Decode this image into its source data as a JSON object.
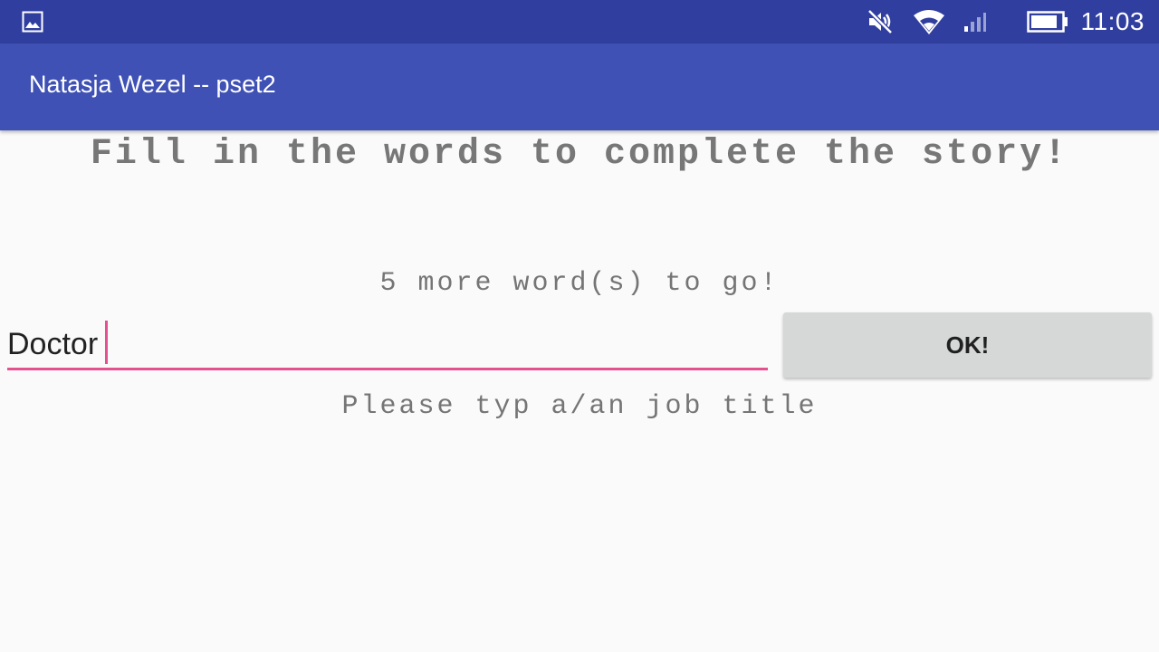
{
  "status_bar": {
    "time": "11:03",
    "icons": [
      "gallery-icon",
      "mute-icon",
      "wifi-icon",
      "signal-icon",
      "battery-icon"
    ],
    "background": "#303f9f"
  },
  "app_bar": {
    "title": "Natasja Wezel -- pset2",
    "background": "#3f51b5"
  },
  "main": {
    "headline": "Fill in the words to complete the story!",
    "counter": "5 more word(s) to go!",
    "input_value": "Doctor",
    "ok_label": "OK!",
    "hint": "Please typ a/an job title",
    "accent_color": "#e5518e"
  }
}
